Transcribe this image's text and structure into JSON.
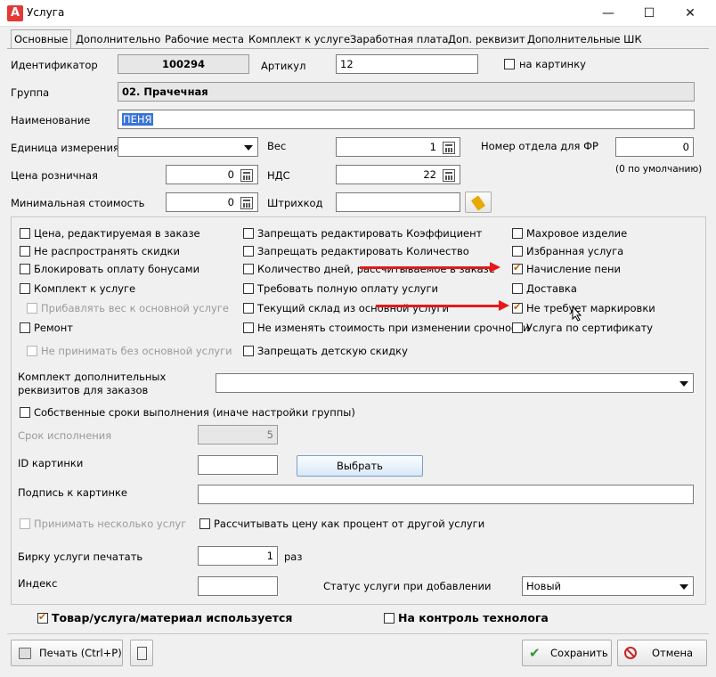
{
  "window": {
    "title": "Услуга",
    "app_icon": "A"
  },
  "tabs": [
    "Основные",
    "Дополнительно",
    "Рабочие места",
    "Комплект к услуге",
    "Заработная плата",
    "Доп. реквизит",
    "Дополнительные ШК"
  ],
  "form": {
    "id_label": "Идентификатор",
    "id_value": "100294",
    "article_label": "Артикул",
    "article_value": "12",
    "on_picture_label": "на картинку",
    "group_label": "Группа",
    "group_value": "02. Прачечная",
    "name_label": "Наименование",
    "name_value": "ПЕНЯ",
    "unit_label": "Единица измерения",
    "unit_value": "",
    "weight_label": "Вес",
    "weight_value": "1",
    "dept_label": "Номер отдела для ФР",
    "dept_value": "0",
    "dept_hint": "(0 по умолчанию)",
    "price_label": "Цена розничная",
    "price_value": "0",
    "vat_label": "НДС",
    "vat_value": "22",
    "minprice_label": "Минимальная стоимость",
    "minprice_value": "0",
    "barcode_label": "Штрихкод",
    "barcode_value": ""
  },
  "checkboxes": {
    "col1": [
      {
        "label": "Цена, редактируемая в заказе",
        "checked": false,
        "disabled": false
      },
      {
        "label": "Не распространять скидки",
        "checked": false,
        "disabled": false
      },
      {
        "label": "Блокировать оплату бонусами",
        "checked": false,
        "disabled": false
      },
      {
        "label": "Комплект к услуге",
        "checked": false,
        "disabled": false
      },
      {
        "label": "Прибавлять вес к основной услуге",
        "checked": false,
        "disabled": true
      },
      {
        "label": "Ремонт",
        "checked": false,
        "disabled": false
      },
      {
        "label": "Не принимать без основной услуги",
        "checked": false,
        "disabled": true
      }
    ],
    "col2": [
      {
        "label": "Запрещать редактировать Коэффициент",
        "checked": false
      },
      {
        "label": "Запрещать редактировать Количество",
        "checked": false
      },
      {
        "label": "Количество дней, рассчитываемое в заказе",
        "checked": false
      },
      {
        "label": "Требовать полную оплату услуги",
        "checked": false
      },
      {
        "label": "Текущий склад из основной услуги",
        "checked": false
      },
      {
        "label": "Не изменять стоимость при изменении срочности",
        "checked": false
      },
      {
        "label": "Запрещать детскую скидку",
        "checked": false
      }
    ],
    "col3": [
      {
        "label": "Махровое изделие",
        "checked": false
      },
      {
        "label": "Избранная услуга",
        "checked": false
      },
      {
        "label": "Начисление пени",
        "checked": true
      },
      {
        "label": "Доставка",
        "checked": false
      },
      {
        "label": "Не требует маркировки",
        "checked": true
      },
      {
        "label": "Услуга по сертификату",
        "checked": false
      }
    ]
  },
  "extra": {
    "kit_label": "Комплект дополнительных реквизитов для заказов",
    "kit_value": "",
    "own_terms_label": "Собственные сроки выполнения (иначе настройки группы)",
    "term_label": "Срок исполнения",
    "term_value": "5",
    "pic_id_label": "ID картинки",
    "pic_id_value": "",
    "choose_label": "Выбрать",
    "caption_label": "Подпись к картинке",
    "caption_value": "",
    "multi_label": "Принимать несколько услуг",
    "percent_label": "Рассчитывать цену как процент от другой услуги",
    "tag_label": "Бирку услуги печатать",
    "tag_value": "1",
    "tag_unit": "раз",
    "index_label": "Индекс",
    "index_value": "",
    "status_label": "Статус услуги при добавлении",
    "status_value": "Новый"
  },
  "bottom": {
    "used_label": "Товар/услуга/материал используется",
    "tech_label": "На контроль технолога",
    "print_label": "Печать (Ctrl+P)",
    "save_label": "Сохранить",
    "cancel_label": "Отмена"
  },
  "colors": {
    "accent": "#e5191b",
    "check": "#c06000",
    "save": "#2e9b2e",
    "cancel": "#c62828"
  }
}
